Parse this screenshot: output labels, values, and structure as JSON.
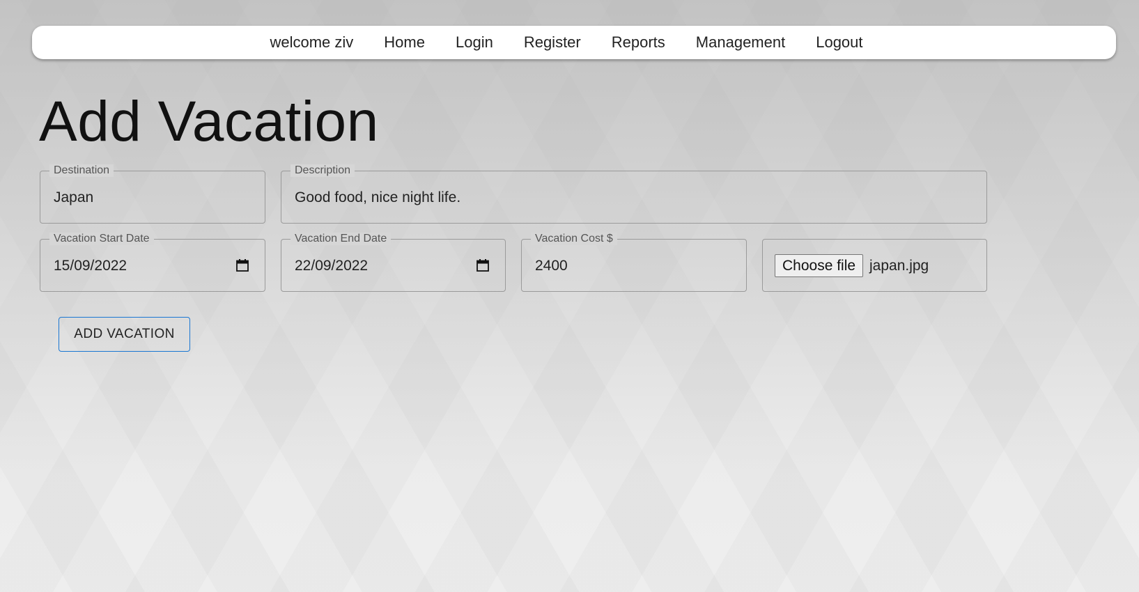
{
  "nav": {
    "welcome": "welcome ziv",
    "links": [
      "Home",
      "Login",
      "Register",
      "Reports",
      "Management",
      "Logout"
    ]
  },
  "page": {
    "title": "Add Vacation"
  },
  "form": {
    "destination": {
      "label": "Destination",
      "value": "Japan"
    },
    "description": {
      "label": "Description",
      "value": "Good food, nice night life."
    },
    "start_date": {
      "label": "Vacation Start Date",
      "value": "15/09/2022"
    },
    "end_date": {
      "label": "Vacation End Date",
      "value": "22/09/2022"
    },
    "cost": {
      "label": "Vacation Cost $",
      "value": "2400"
    },
    "file": {
      "button_label": "Choose file",
      "file_name": "japan.jpg"
    },
    "submit_label": "ADD VACATION"
  },
  "colors": {
    "accent_border": "#1976d2",
    "navbar_bg": "#ffffff"
  },
  "icons": {
    "date_picker": "calendar-icon"
  }
}
